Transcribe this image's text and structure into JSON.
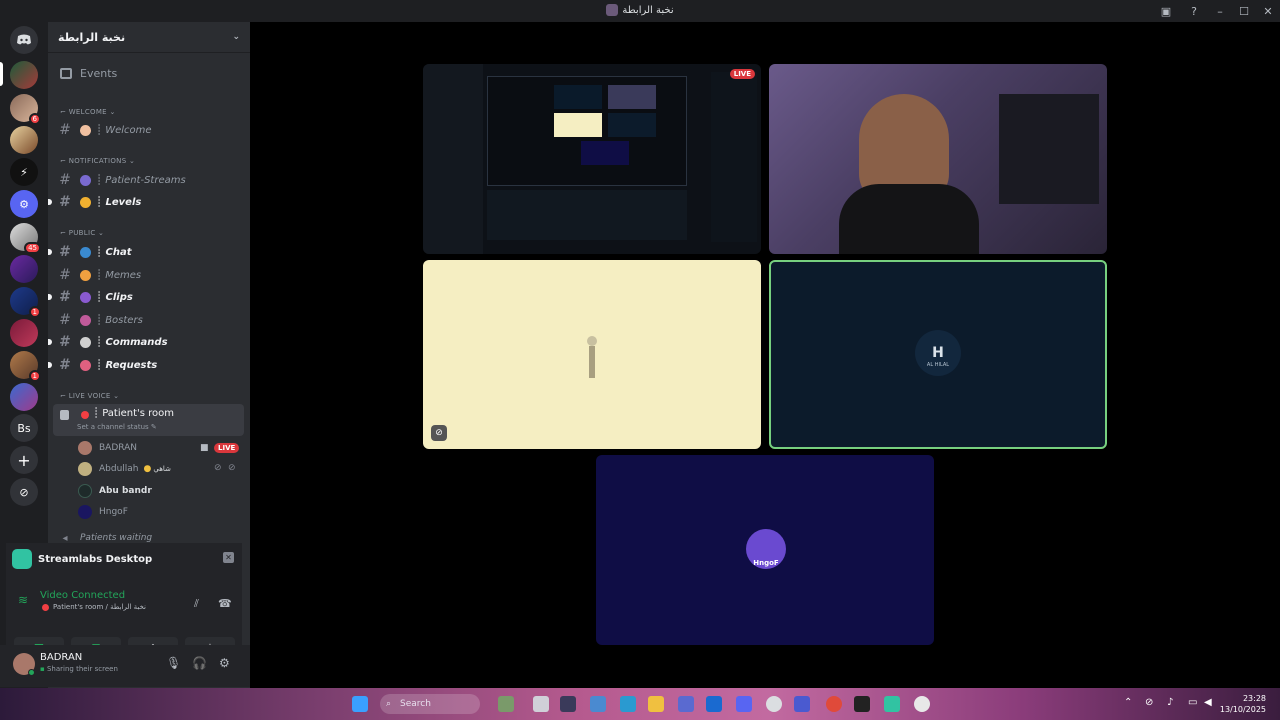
{
  "window": {
    "title": "نخبة الرابطة",
    "help_icon": "help-icon",
    "inbox_icon": "inbox-icon"
  },
  "guild_rail": {
    "badges": [
      "6",
      "45",
      "1",
      "1"
    ],
    "text_server": "Bs"
  },
  "server": {
    "name": "نخبة الرابطة",
    "events_label": "Events"
  },
  "categories": {
    "welcome": "WELCOME",
    "notifications": "NOTIFICATIONS",
    "public": "PUBLIC",
    "live_voice": "LIVE VOICE"
  },
  "channels": {
    "welcome": "┊ Welcome",
    "patient_streams": "┊ Patient-Streams",
    "levels": "┊ Levels",
    "chat": "┊ Chat",
    "memes": "┊ Memes",
    "clips": "┊ Clips",
    "bosters": "┊ Bosters",
    "commands": "┊ Commands",
    "requests": "┊ Requests"
  },
  "voice": {
    "room_name": "┊ Patient's room",
    "room_status": "Set a channel status",
    "users": [
      {
        "name": "BADRAN"
      },
      {
        "name": "Abdullah"
      },
      {
        "name": "Abu bandr"
      },
      {
        "name": "HngoF"
      }
    ],
    "user_tag": "شاهي",
    "live_label": "LIVE",
    "next_channel": "Patients waiting"
  },
  "streamlabs": {
    "title": "Streamlabs Desktop",
    "status": "Video Connected",
    "location": "Patient's room / نخبة الرابطة"
  },
  "user": {
    "name": "BADRAN",
    "status": "Sharing their screen"
  },
  "stage": {
    "live_label": "LIVE",
    "tile_alhilal_text": "AL HILAL",
    "tile_hngof_text": "HngoF"
  },
  "taskbar": {
    "search_placeholder": "Search",
    "time": "23:28",
    "date": "13/10/2025"
  },
  "colors": {
    "discord_green": "#23a55a",
    "discord_red": "#f23f43",
    "highlight_border": "#77d07f"
  }
}
